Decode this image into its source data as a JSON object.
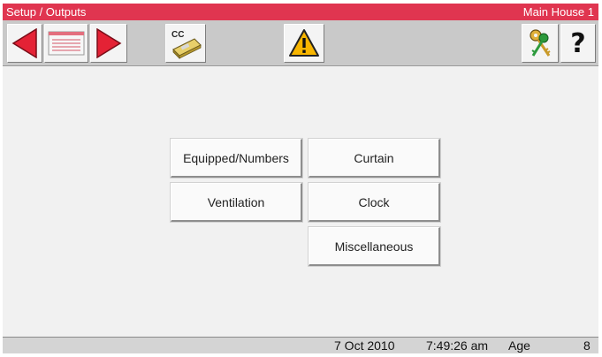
{
  "titlebar": {
    "screen_title": "Setup / Outputs",
    "house_name": "Main House 1"
  },
  "toolbar": {
    "icons": [
      "arrow-left-icon",
      "list-icon",
      "arrow-right-icon",
      "climate-computer-icon",
      "warning-icon",
      "keys-icon",
      "help-icon"
    ],
    "cc_label": "CC",
    "help_symbol": "?"
  },
  "menu": {
    "equipped_numbers": "Equipped/Numbers",
    "curtain": "Curtain",
    "ventilation": "Ventilation",
    "clock": "Clock",
    "miscellaneous": "Miscellaneous"
  },
  "status": {
    "date": "7 Oct 2010",
    "time": "7:49:26 am",
    "age_label": "Age",
    "age_value": "8"
  },
  "colors": {
    "title_bar": "#e03550",
    "arrow_red": "#e42235",
    "warning_yellow": "#f7b500"
  }
}
